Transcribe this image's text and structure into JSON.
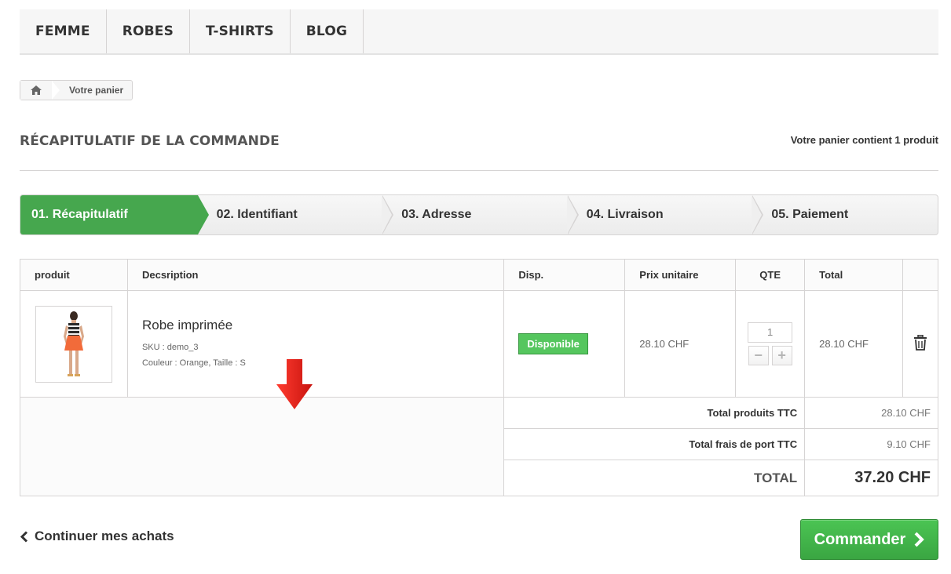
{
  "nav": {
    "items": [
      {
        "label": "FEMME"
      },
      {
        "label": "ROBES"
      },
      {
        "label": "T-SHIRTS"
      },
      {
        "label": "BLOG"
      }
    ]
  },
  "breadcrumb": {
    "home_icon": "home-icon",
    "current": "Votre panier"
  },
  "heading": {
    "title": "RÉCAPITULATIF DE LA COMMANDE",
    "cart_count": "Votre panier contient 1 produit"
  },
  "steps": [
    {
      "label": "01. Récapitulatif",
      "active": true
    },
    {
      "label": "02. Identifiant"
    },
    {
      "label": "03. Adresse"
    },
    {
      "label": "04. Livraison"
    },
    {
      "label": "05. Paiement"
    }
  ],
  "table": {
    "headers": {
      "product": "produit",
      "description": "Decsription",
      "availability": "Disp.",
      "unit_price": "Prix unitaire",
      "qty": "QTE",
      "total": "Total"
    },
    "item": {
      "name": "Robe imprimée",
      "sku": "SKU : demo_3",
      "attributes": "Couleur : Orange, Taille : S",
      "availability": "Disponible",
      "unit_price": "28.10 CHF",
      "qty": "1",
      "qty_minus": "−",
      "qty_plus": "+",
      "total": "28.10 CHF",
      "delete_icon": "trash-icon"
    },
    "summary": {
      "products_label": "Total produits TTC",
      "products_value": "28.10 CHF",
      "shipping_label": "Total frais de port TTC",
      "shipping_value": "9.10 CHF",
      "total_label": "TOTAL",
      "total_value": "37.20 CHF"
    }
  },
  "actions": {
    "continue_label": "Continuer mes achats",
    "order_label": "Commander"
  },
  "colors": {
    "accent_green": "#46a74e",
    "button_green": "#3aa642",
    "annotation_red": "#e0231c"
  }
}
